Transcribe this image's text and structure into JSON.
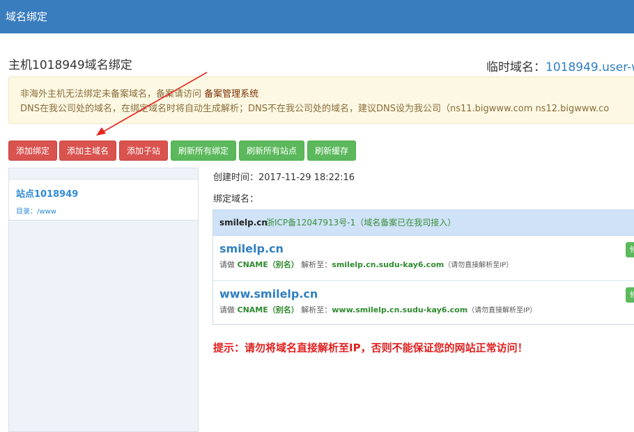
{
  "topbar": {
    "title": "域名绑定"
  },
  "header": {
    "host_title": "主机1018949域名绑定",
    "temp_domain_label": "临时域名：",
    "temp_domain_value": "1018949.user-w"
  },
  "alert": {
    "line1_text": "非海外主机无法绑定未备案域名，备案请访问 ",
    "line1_link": "备案管理系统",
    "line2": "DNS在我公司处的域名，在绑定域名时将自动生成解析；DNS不在我公司处的域名，建议DNS设为我公司（ns11.bigwww.com ns12.bigwww.co"
  },
  "buttons": {
    "add_binding": "添加绑定",
    "add_main_domain": "添加主域名",
    "add_subsite": "添加子站",
    "refresh_bindings": "刷新所有绑定",
    "refresh_sites": "刷新所有站点",
    "refresh_cache": "刷新缓存"
  },
  "sidebar": {
    "site_name": "站点1018949",
    "site_dir": "目录：/www"
  },
  "detail": {
    "created": "创建时间：2017-11-29 18:22:16",
    "bind_label": "绑定域名：",
    "head_domain": "smilelp.cn",
    "head_icp": "浙ICP备12047913号-1（域名备案已在我司接入）",
    "entries": [
      {
        "domain": "smilelp.cn",
        "prefix": "请做 ",
        "cname": "CNAME（别名）",
        "mid": " 解析至：",
        "target": "smilelp.cn.sudu-kay6.com",
        "note": "（请勿直接解析至IP）",
        "edit": "修"
      },
      {
        "domain": "www.smilelp.cn",
        "prefix": "请做 ",
        "cname": "CNAME（别名）",
        "mid": " 解析至：",
        "target": "www.smilelp.cn.sudu-kay6.com",
        "note": "（请勿直接解析至IP）",
        "edit": "修"
      }
    ]
  },
  "tip": "提示：请勿将域名直接解析至IP，否则不能保证您的网站正常访问！",
  "colors": {
    "topbar": "#3a7dbf",
    "red_button": "#d9534f",
    "green_button": "#5cb85c",
    "link_blue": "#2f7fc1",
    "warning_red": "#e02020",
    "annotation_arrow": "#e8231f"
  }
}
